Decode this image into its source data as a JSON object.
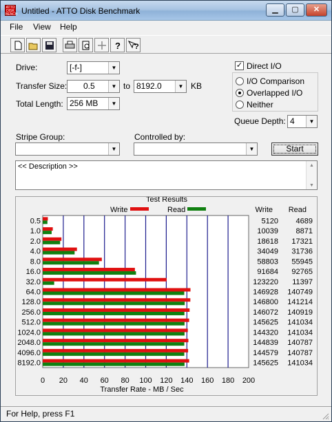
{
  "window": {
    "title": "Untitled - ATTO Disk Benchmark",
    "app_icon_text": "ATTO DISK BENCH"
  },
  "window_controls": {
    "minimize": "▁",
    "maximize": "▢",
    "close": "✕"
  },
  "menu": {
    "file": "File",
    "view": "View",
    "help": "Help"
  },
  "toolbar": [
    "new-icon",
    "open-icon",
    "save-icon",
    "print-icon",
    "print-preview-icon",
    "move-icon",
    "help-icon",
    "context-help-icon"
  ],
  "settings": {
    "drive_label": "Drive:",
    "drive_value": "[-f-]",
    "transfer_size_label": "Transfer Size:",
    "transfer_from": "0.5",
    "to_label": "to",
    "transfer_to": "8192.0",
    "kb_label": "KB",
    "total_length_label": "Total Length:",
    "total_length_value": "256 MB",
    "direct_io_label": "Direct I/O",
    "direct_io_checked": true,
    "io_comparison_label": "I/O Comparison",
    "overlapped_io_label": "Overlapped I/O",
    "neither_label": "Neither",
    "selected_mode": "overlapped",
    "queue_depth_label": "Queue Depth:",
    "queue_depth_value": "4",
    "stripe_group_label": "Stripe Group:",
    "stripe_group_value": "",
    "controlled_by_label": "Controlled by:",
    "controlled_by_value": "",
    "start_label": "Start",
    "description": "<< Description >>"
  },
  "results": {
    "title": "Test Results",
    "legend_write": "Write",
    "legend_read": "Read",
    "col_write": "Write",
    "col_read": "Read",
    "write_color": "#e01010",
    "read_color": "#108010"
  },
  "chart_data": {
    "type": "bar",
    "orientation": "horizontal",
    "title": "Test Results",
    "xlabel": "Transfer Rate - MB / Sec",
    "xlim": [
      0,
      200
    ],
    "x_ticks": [
      0,
      20,
      40,
      60,
      80,
      100,
      120,
      140,
      160,
      180,
      200
    ],
    "categories": [
      "0.5",
      "1.0",
      "2.0",
      "4.0",
      "8.0",
      "16.0",
      "32.0",
      "64.0",
      "128.0",
      "256.0",
      "512.0",
      "1024.0",
      "2048.0",
      "4096.0",
      "8192.0"
    ],
    "series": [
      {
        "name": "Write",
        "values_kb": [
          5120,
          10039,
          18618,
          34049,
          58803,
          91684,
          123220,
          146928,
          146800,
          146072,
          145625,
          144320,
          144839,
          144579,
          145625
        ]
      },
      {
        "name": "Read",
        "values_kb": [
          4689,
          8871,
          17321,
          31736,
          55945,
          92765,
          11397,
          140749,
          141214,
          140919,
          141034,
          141034,
          140787,
          140787,
          141034
        ]
      }
    ],
    "grid": "vertical"
  },
  "status": {
    "text": "For Help, press F1"
  }
}
